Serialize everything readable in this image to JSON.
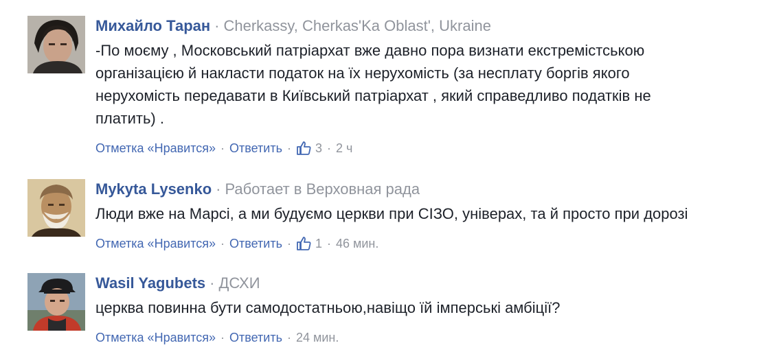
{
  "comments": [
    {
      "author": "Михайло Таран",
      "location": "Cherkassy, Cherkas'Ka Oblast', Ukraine",
      "lines": [
        "-По моєму , Московський патріархат вже давно пора визнати екстремістською",
        "організацією й накласти податок на їх нерухомість (за несплату боргів якого",
        "нерухомість передавати в Київський патріархат , який справедливо податків не",
        "платить) ."
      ],
      "like_label": "Отметка «Нравится»",
      "reply_label": "Ответить",
      "like_count": "3",
      "time": "2 ч",
      "like_icon": "thumbs-up-icon"
    },
    {
      "author": "Mykyta Lysenko",
      "location": "Работает в Верховная рада",
      "lines": [
        "Люди вже на Марсі, а ми будуємо церкви при СІЗО, універах, та й просто при дорозі"
      ],
      "like_label": "Отметка «Нравится»",
      "reply_label": "Ответить",
      "like_count": "1",
      "time": "46 мин.",
      "like_icon": "thumbs-up-icon"
    },
    {
      "author": "Wasil Yagubets",
      "location": "ДСХИ",
      "lines": [
        "церква повинна бути самодостатньою,навіщо їй імперські амбіції?"
      ],
      "like_label": "Отметка «Нравится»",
      "reply_label": "Ответить",
      "time": "24 мин."
    }
  ],
  "colors": {
    "author": "#365899",
    "action_link": "#4267b2",
    "meta": "#90949c",
    "text": "#1d2129"
  }
}
